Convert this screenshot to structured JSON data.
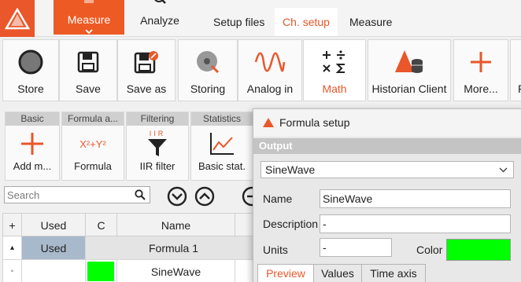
{
  "topbar": {
    "main_tabs": {
      "measure": "Measure",
      "analyze": "Analyze"
    },
    "sub_tabs": {
      "setup_files": "Setup files",
      "ch_setup": "Ch. setup",
      "measure": "Measure"
    }
  },
  "ribbon": {
    "store": "Store",
    "save": "Save",
    "save_as": "Save as",
    "storing": "Storing",
    "analog_in": "Analog in",
    "math": "Math",
    "historian_client": "Historian Client",
    "more": "More...",
    "overflow": "F"
  },
  "tool_groups": {
    "basic": {
      "header": "Basic",
      "label": "Add m..."
    },
    "formula": {
      "header": "Formula a...",
      "label": "Formula",
      "icon_text": "X²+Y²"
    },
    "filtering": {
      "header": "Filtering",
      "label": "IIR filter",
      "icon_text": "IIR"
    },
    "statistics": {
      "header": "Statistics",
      "label": "Basic stat."
    }
  },
  "search": {
    "placeholder": "Search",
    "value": ""
  },
  "table": {
    "headers": {
      "expand": "+",
      "used": "Used",
      "color": "C",
      "name": "Name"
    },
    "group_row": {
      "toggle": "▴",
      "used": "Used",
      "name": "Formula 1"
    },
    "channel_row": {
      "marker": "◦",
      "name": "SineWave",
      "color": "#00ff00"
    }
  },
  "dialog": {
    "title": "Formula setup",
    "section": "Output",
    "output_selected": "SineWave",
    "name_label": "Name",
    "name_value": "SineWave",
    "description_label": "Description",
    "description_value": "-",
    "units_label": "Units",
    "units_value": "-",
    "color_label": "Color",
    "color_value": "#00ff00",
    "tabs": {
      "preview": "Preview",
      "values": "Values",
      "time_axis": "Time axis"
    }
  },
  "colors": {
    "accent": "#e9572a",
    "channel_green": "#00ff00",
    "used_cell": "#a9b9cc"
  }
}
